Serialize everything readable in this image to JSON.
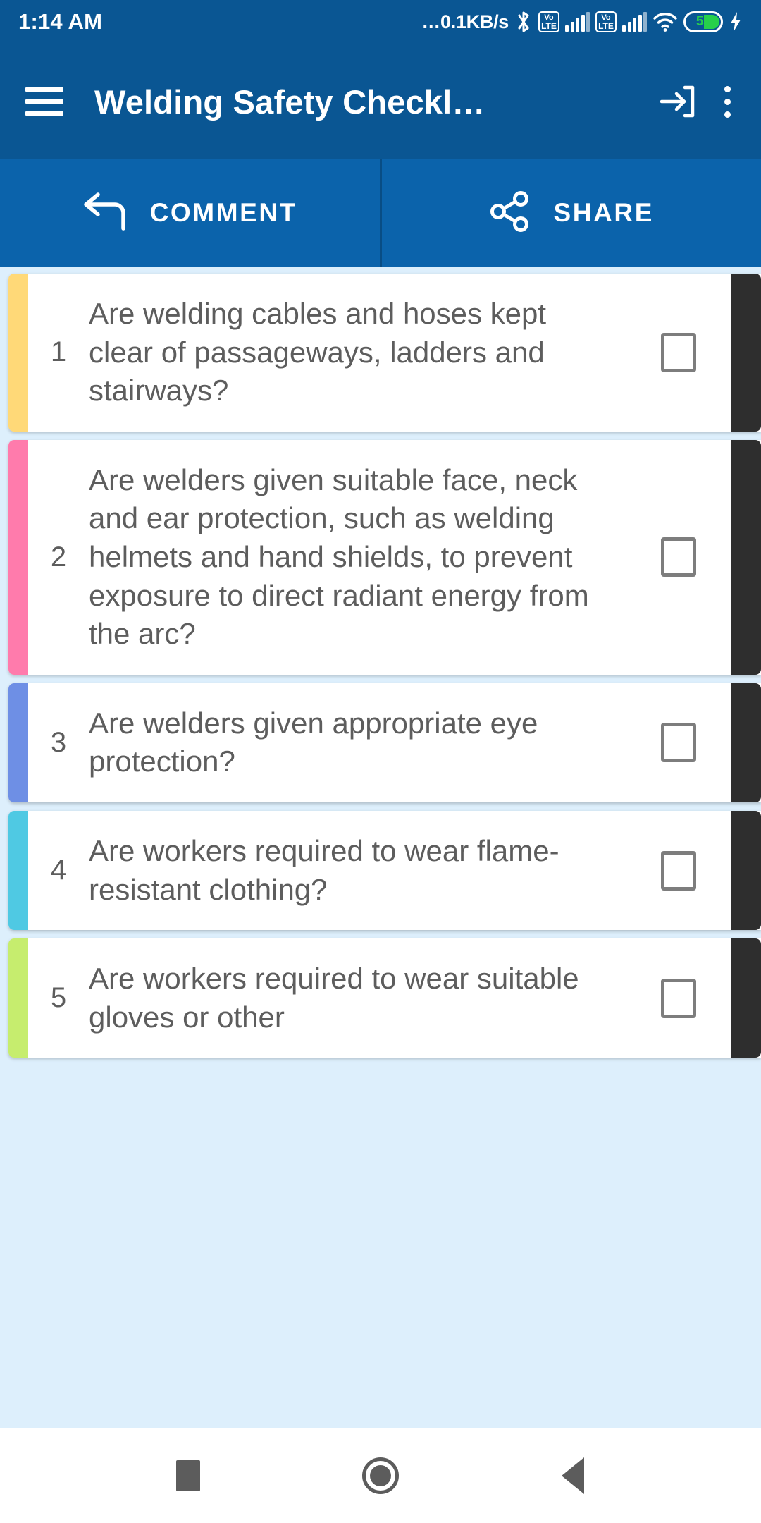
{
  "status_bar": {
    "time": "1:14 AM",
    "network_speed": "0.1KB/s",
    "speed_dots": "...",
    "bluetooth_icon": "bluetooth-icon",
    "volte_top": "Vo",
    "volte_bottom": "LTE",
    "wifi_icon": "wifi-icon",
    "battery_level": "53",
    "charging_icon": "charging-bolt-icon"
  },
  "toolbar": {
    "menu_icon": "hamburger-menu-icon",
    "title": "Welding Safety Checkl…",
    "login_icon": "login-arrow-icon",
    "overflow_icon": "more-vertical-icon"
  },
  "action_bar": {
    "comment_label": "COMMENT",
    "comment_icon": "reply-arrow-icon",
    "share_label": "SHARE",
    "share_icon": "share-nodes-icon"
  },
  "checklist": {
    "items": [
      {
        "number": "1",
        "question": "Are welding cables and hoses kept clear of passageways, ladders and stairways?",
        "stripe_color": "#FFD978",
        "checked": false
      },
      {
        "number": "2",
        "question": "Are welders given suitable face, neck and ear protection, such as welding helmets and hand shields, to prevent exposure to direct radiant energy from the arc?",
        "stripe_color": "#FF7BAC",
        "checked": false
      },
      {
        "number": "3",
        "question": "Are welders given appropriate eye protection?",
        "stripe_color": "#6E8FE5",
        "checked": false
      },
      {
        "number": "4",
        "question": "Are workers required to wear flame-resistant clothing?",
        "stripe_color": "#4FC9E3",
        "checked": false
      },
      {
        "number": "5",
        "question": "Are workers required to wear suitable gloves or other",
        "stripe_color": "#C6ED6E",
        "checked": false
      }
    ]
  },
  "nav_bar": {
    "recents_icon": "recents-square-icon",
    "home_icon": "home-circle-icon",
    "back_icon": "back-triangle-icon"
  },
  "colors": {
    "status_bar_bg": "#0a5693",
    "toolbar_bg": "#0a5693",
    "action_bar_bg": "#0b63ab",
    "content_bg": "#ddeffc",
    "card_bg": "#ffffff",
    "card_edge": "#2e2e2e",
    "text": "#5d5d5d"
  }
}
